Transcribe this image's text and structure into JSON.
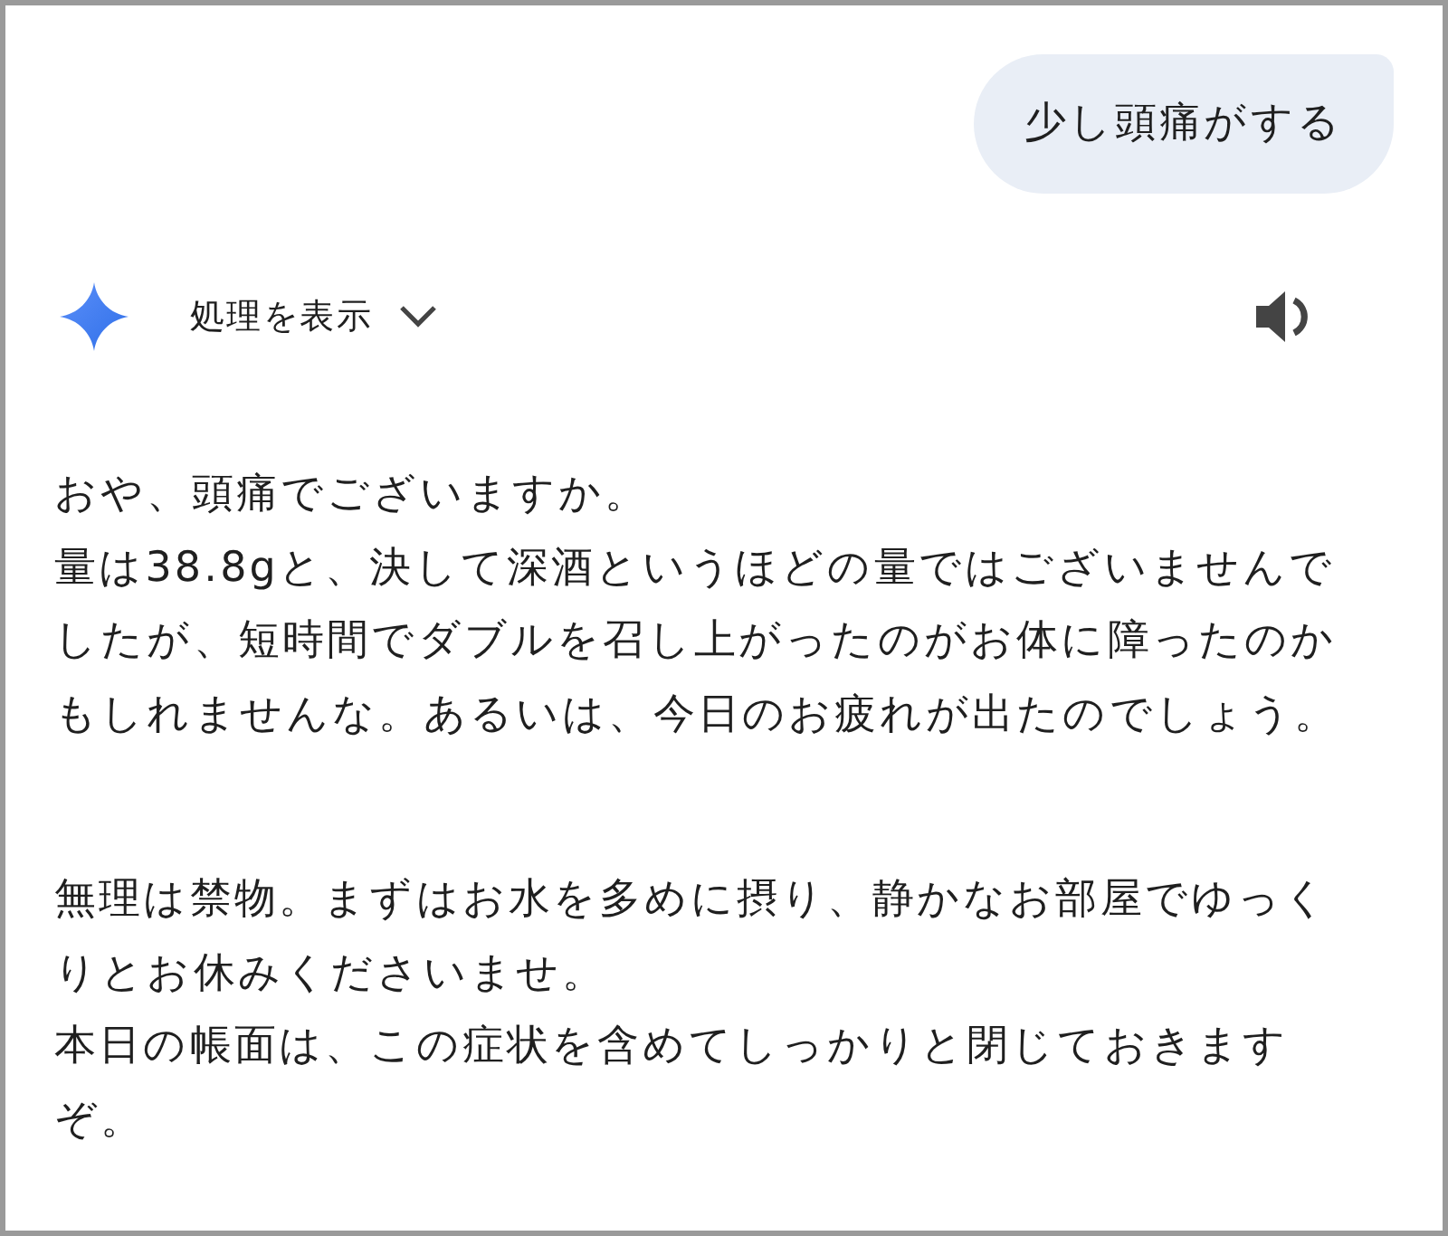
{
  "user_message": {
    "text": "少し頭痛がする"
  },
  "response": {
    "thoughts_toggle": {
      "label": "処理を表示",
      "expanded": false
    },
    "paragraphs": [
      {
        "lines": [
          "おや、頭痛でございますか。",
          "量は38.8gと、決して深酒というほどの量ではございませんでしたが、短時間でダブルを召し上がったのがお体に障ったのかもしれませんな。あるいは、今日のお疲れが出たのでしょう。"
        ]
      },
      {
        "lines": [
          "無理は禁物。まずはお水を多めに摂り、静かなお部屋でゆっくりとお休みくださいませ。",
          "本日の帳面は、この症状を含めてしっかりと閉じておきますぞ。"
        ]
      }
    ]
  }
}
